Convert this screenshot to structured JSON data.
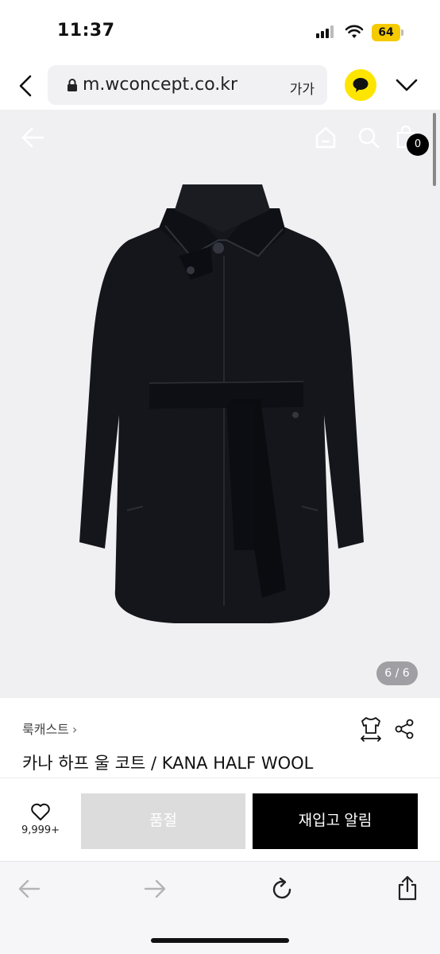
{
  "status_bar": {
    "time": "11:37",
    "battery": "64"
  },
  "browser": {
    "url": "m.wconcept.co.kr",
    "text_size_label": "가가"
  },
  "product_image": {
    "page_indicator": "6 / 6",
    "cart_count": "0"
  },
  "product": {
    "brand": "룩캐스트",
    "title": "카나 하프 울 코트 / KANA HALF WOOL"
  },
  "actions": {
    "wish_count": "9,999+",
    "soldout_label": "품절",
    "restock_label": "재입고 알림"
  },
  "colors": {
    "accent": "#000000",
    "kakao": "#fee500",
    "battery": "#f5cb00",
    "soldout": "#dcdcdc"
  },
  "icons": [
    "chevron-left-icon",
    "lock-icon",
    "kakao-chat-icon",
    "chevron-down-icon",
    "arrow-left-icon",
    "home-icon",
    "search-icon",
    "shopping-bag-icon",
    "size-guide-icon",
    "share-icon",
    "heart-icon",
    "reload-icon",
    "arrow-right-icon"
  ]
}
